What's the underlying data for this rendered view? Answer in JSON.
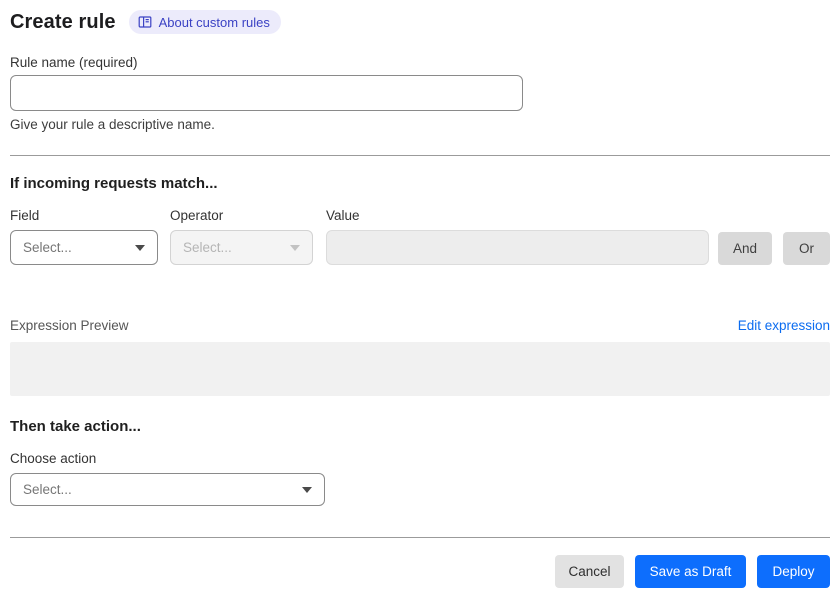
{
  "header": {
    "title": "Create rule",
    "about_badge_label": "About custom rules"
  },
  "rule_name": {
    "label": "Rule name (required)",
    "value": "",
    "help": "Give your rule a descriptive name."
  },
  "match_section": {
    "heading": "If incoming requests match...",
    "field": {
      "label": "Field",
      "placeholder": "Select..."
    },
    "operator": {
      "label": "Operator",
      "placeholder": "Select..."
    },
    "value": {
      "label": "Value",
      "value": ""
    },
    "and_button": "And",
    "or_button": "Or",
    "expression_preview_label": "Expression Preview",
    "edit_expression_link": "Edit expression",
    "expression_value": ""
  },
  "action_section": {
    "heading": "Then take action...",
    "choose_action_label": "Choose action",
    "action_placeholder": "Select..."
  },
  "footer": {
    "cancel": "Cancel",
    "save_draft": "Save as Draft",
    "deploy": "Deploy"
  },
  "colors": {
    "primary_blue": "#0d6efd",
    "badge_bg": "#ecebfb",
    "badge_text": "#3b42c4",
    "link_blue": "#0b6cf0",
    "divider_gray": "#9b9b9b"
  }
}
